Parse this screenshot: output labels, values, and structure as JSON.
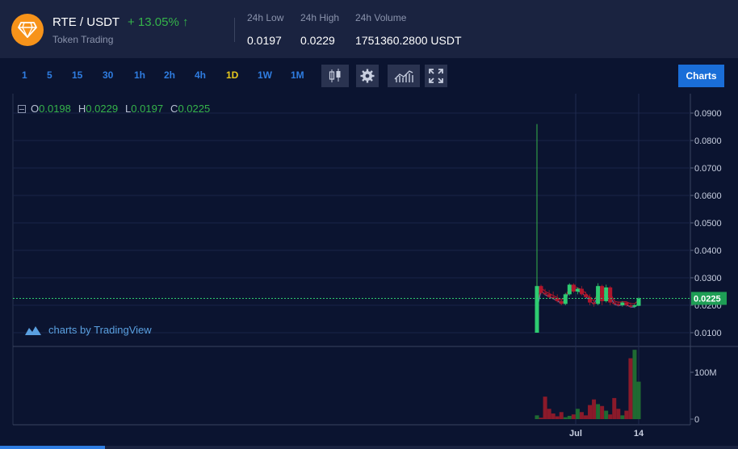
{
  "header": {
    "pair": "RTE / USDT",
    "subtitle": "Token Trading",
    "change": "+ 13.05% ↑",
    "stats": [
      {
        "label": "24h Low",
        "value": "0.0197"
      },
      {
        "label": "24h High",
        "value": "0.0229"
      },
      {
        "label": "24h Volume",
        "value": "1751360.2800 USDT"
      }
    ]
  },
  "toolbar": {
    "intervals": [
      "1",
      "5",
      "15",
      "30",
      "1h",
      "2h",
      "4h",
      "1D",
      "1W",
      "1M"
    ],
    "active_interval": "1D",
    "tools": [
      "candlestick-icon",
      "gear-icon",
      "indicators-icon",
      "fullscreen-icon"
    ],
    "charts_label": "Charts"
  },
  "legend": {
    "o_label": "O",
    "o_value": "0.0198",
    "h_label": "H",
    "h_value": "0.0229",
    "l_label": "L",
    "l_value": "0.0197",
    "c_label": "C",
    "c_value": "0.0225"
  },
  "watermark": "charts by TradingView",
  "colors": {
    "up": "#26a65b",
    "down": "#8b1a2a",
    "accent": "#1a6ed8",
    "interval_active": "#e8c91d"
  },
  "chart_data": {
    "type": "candlestick",
    "price_ticks": [
      "0.0900",
      "0.0800",
      "0.0700",
      "0.0600",
      "0.0500",
      "0.0400",
      "0.0300",
      "0.0200",
      "0.0100"
    ],
    "last_price_label": "0.0225",
    "volume_ticks": [
      "100M",
      "0"
    ],
    "time_ticks": [
      "Jul",
      "14"
    ],
    "candles": [
      {
        "o": 0.01,
        "h": 0.086,
        "l": 0.01,
        "c": 0.027
      },
      {
        "o": 0.027,
        "h": 0.0275,
        "l": 0.024,
        "c": 0.0245
      },
      {
        "o": 0.0245,
        "h": 0.026,
        "l": 0.0235,
        "c": 0.024
      },
      {
        "o": 0.024,
        "h": 0.0255,
        "l": 0.0225,
        "c": 0.023
      },
      {
        "o": 0.023,
        "h": 0.025,
        "l": 0.022,
        "c": 0.0225
      },
      {
        "o": 0.0225,
        "h": 0.024,
        "l": 0.021,
        "c": 0.0215
      },
      {
        "o": 0.0215,
        "h": 0.0225,
        "l": 0.02,
        "c": 0.0205
      },
      {
        "o": 0.0205,
        "h": 0.0245,
        "l": 0.02,
        "c": 0.024
      },
      {
        "o": 0.024,
        "h": 0.028,
        "l": 0.0235,
        "c": 0.0275
      },
      {
        "o": 0.0275,
        "h": 0.028,
        "l": 0.0245,
        "c": 0.025
      },
      {
        "o": 0.025,
        "h": 0.0265,
        "l": 0.024,
        "c": 0.026
      },
      {
        "o": 0.026,
        "h": 0.027,
        "l": 0.0235,
        "c": 0.024
      },
      {
        "o": 0.024,
        "h": 0.025,
        "l": 0.0225,
        "c": 0.023
      },
      {
        "o": 0.023,
        "h": 0.024,
        "l": 0.02,
        "c": 0.021
      },
      {
        "o": 0.021,
        "h": 0.022,
        "l": 0.0195,
        "c": 0.0205
      },
      {
        "o": 0.0205,
        "h": 0.028,
        "l": 0.02,
        "c": 0.027
      },
      {
        "o": 0.027,
        "h": 0.0275,
        "l": 0.02,
        "c": 0.0215
      },
      {
        "o": 0.0215,
        "h": 0.0275,
        "l": 0.021,
        "c": 0.0265
      },
      {
        "o": 0.0265,
        "h": 0.027,
        "l": 0.02,
        "c": 0.021
      },
      {
        "o": 0.021,
        "h": 0.0225,
        "l": 0.02,
        "c": 0.0205
      },
      {
        "o": 0.0205,
        "h": 0.0215,
        "l": 0.0195,
        "c": 0.02
      },
      {
        "o": 0.02,
        "h": 0.0215,
        "l": 0.0195,
        "c": 0.021
      },
      {
        "o": 0.021,
        "h": 0.0215,
        "l": 0.0195,
        "c": 0.02
      },
      {
        "o": 0.02,
        "h": 0.021,
        "l": 0.019,
        "c": 0.0195
      },
      {
        "o": 0.0195,
        "h": 0.0205,
        "l": 0.019,
        "c": 0.02
      },
      {
        "o": 0.0198,
        "h": 0.0229,
        "l": 0.0197,
        "c": 0.0225
      }
    ],
    "volumes": [
      8,
      3,
      48,
      22,
      12,
      6,
      15,
      4,
      7,
      10,
      22,
      15,
      8,
      30,
      42,
      32,
      28,
      18,
      10,
      45,
      22,
      8,
      18,
      130,
      148,
      80
    ],
    "volume_ylim": [
      0,
      150
    ]
  }
}
